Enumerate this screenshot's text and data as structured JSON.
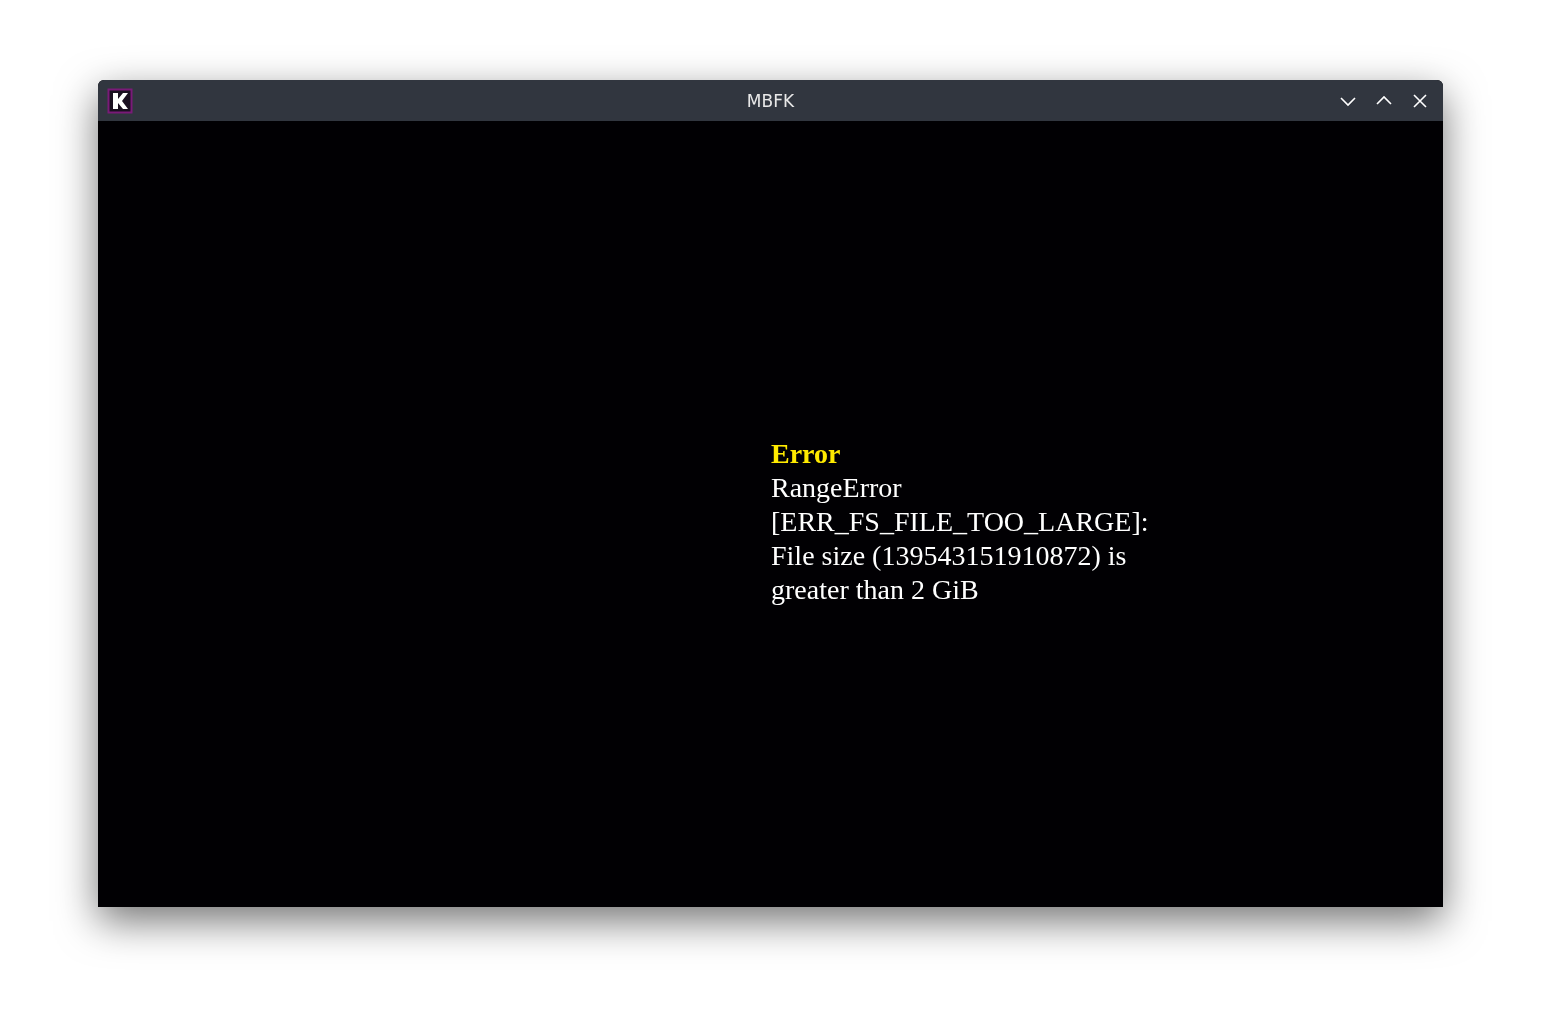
{
  "window": {
    "title": "MBFK"
  },
  "error": {
    "heading": "Error",
    "message": "RangeError [ERR_FS_FILE_TOO_LARGE]: File size (139543151910872) is greater than 2 GiB"
  }
}
